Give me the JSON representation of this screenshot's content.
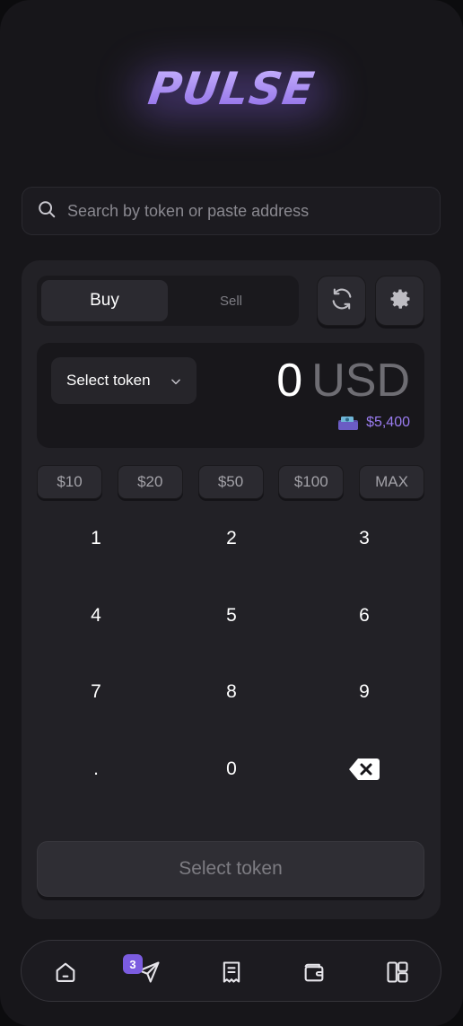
{
  "app": {
    "logo_text": "PULSE"
  },
  "search": {
    "placeholder": "Search by token or paste address"
  },
  "trade": {
    "tabs": [
      {
        "label": "Buy",
        "active": true
      },
      {
        "label": "Sell",
        "active": false
      }
    ],
    "token_select_label": "Select token",
    "amount_value": "0",
    "amount_currency": "USD",
    "balance": "$5,400",
    "quick_amounts": [
      "$10",
      "$20",
      "$50",
      "$100",
      "MAX"
    ],
    "keypad": [
      "1",
      "2",
      "3",
      "4",
      "5",
      "6",
      "7",
      "8",
      "9",
      ".",
      "0",
      "backspace"
    ],
    "cta_label": "Select token"
  },
  "nav": {
    "items": [
      "home",
      "send",
      "receipts",
      "wallet",
      "layout"
    ],
    "send_badge": "3"
  },
  "colors": {
    "accent": "#9a7cf0",
    "badge": "#7b5ce0",
    "background": "#17161a",
    "card": "#222126"
  }
}
